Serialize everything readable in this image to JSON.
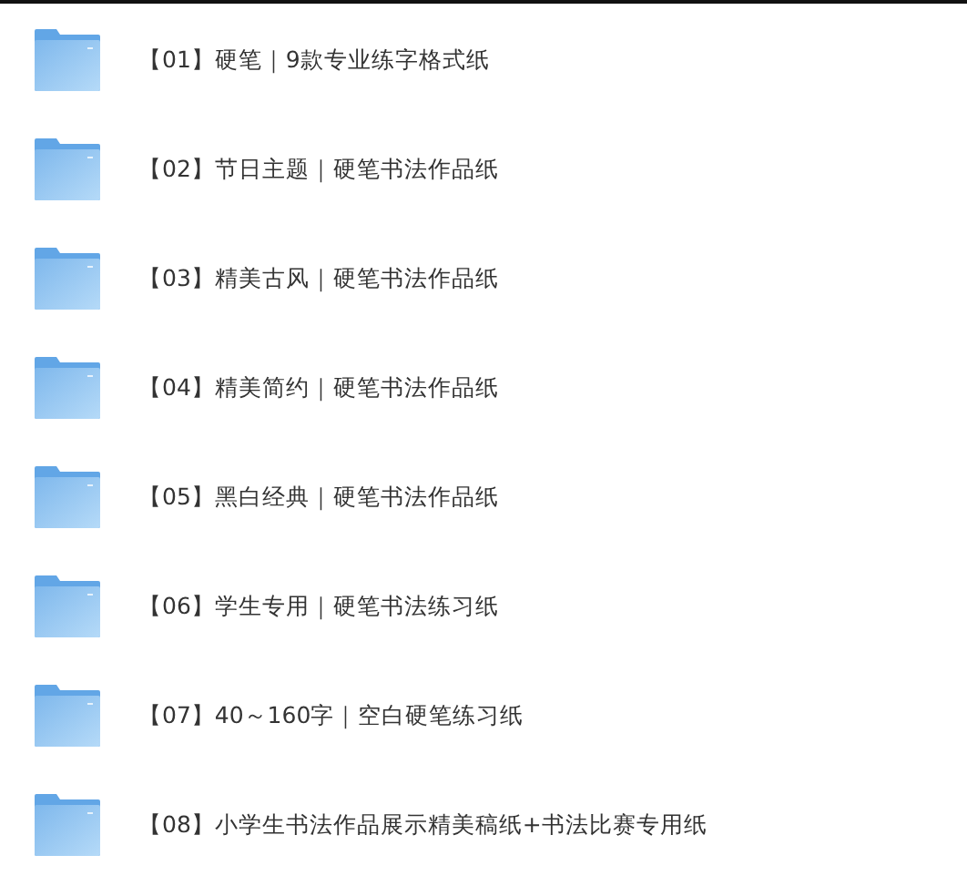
{
  "folders": [
    {
      "name": "【01】硬笔｜9款专业练字格式纸"
    },
    {
      "name": "【02】节日主题｜硬笔书法作品纸"
    },
    {
      "name": "【03】精美古风｜硬笔书法作品纸"
    },
    {
      "name": "【04】精美简约｜硬笔书法作品纸"
    },
    {
      "name": "【05】黑白经典｜硬笔书法作品纸"
    },
    {
      "name": "【06】学生专用｜硬笔书法练习纸"
    },
    {
      "name": "【07】40～160字｜空白硬笔练习纸"
    },
    {
      "name": "【08】小学生书法作品展示精美稿纸+书法比赛专用纸"
    }
  ]
}
